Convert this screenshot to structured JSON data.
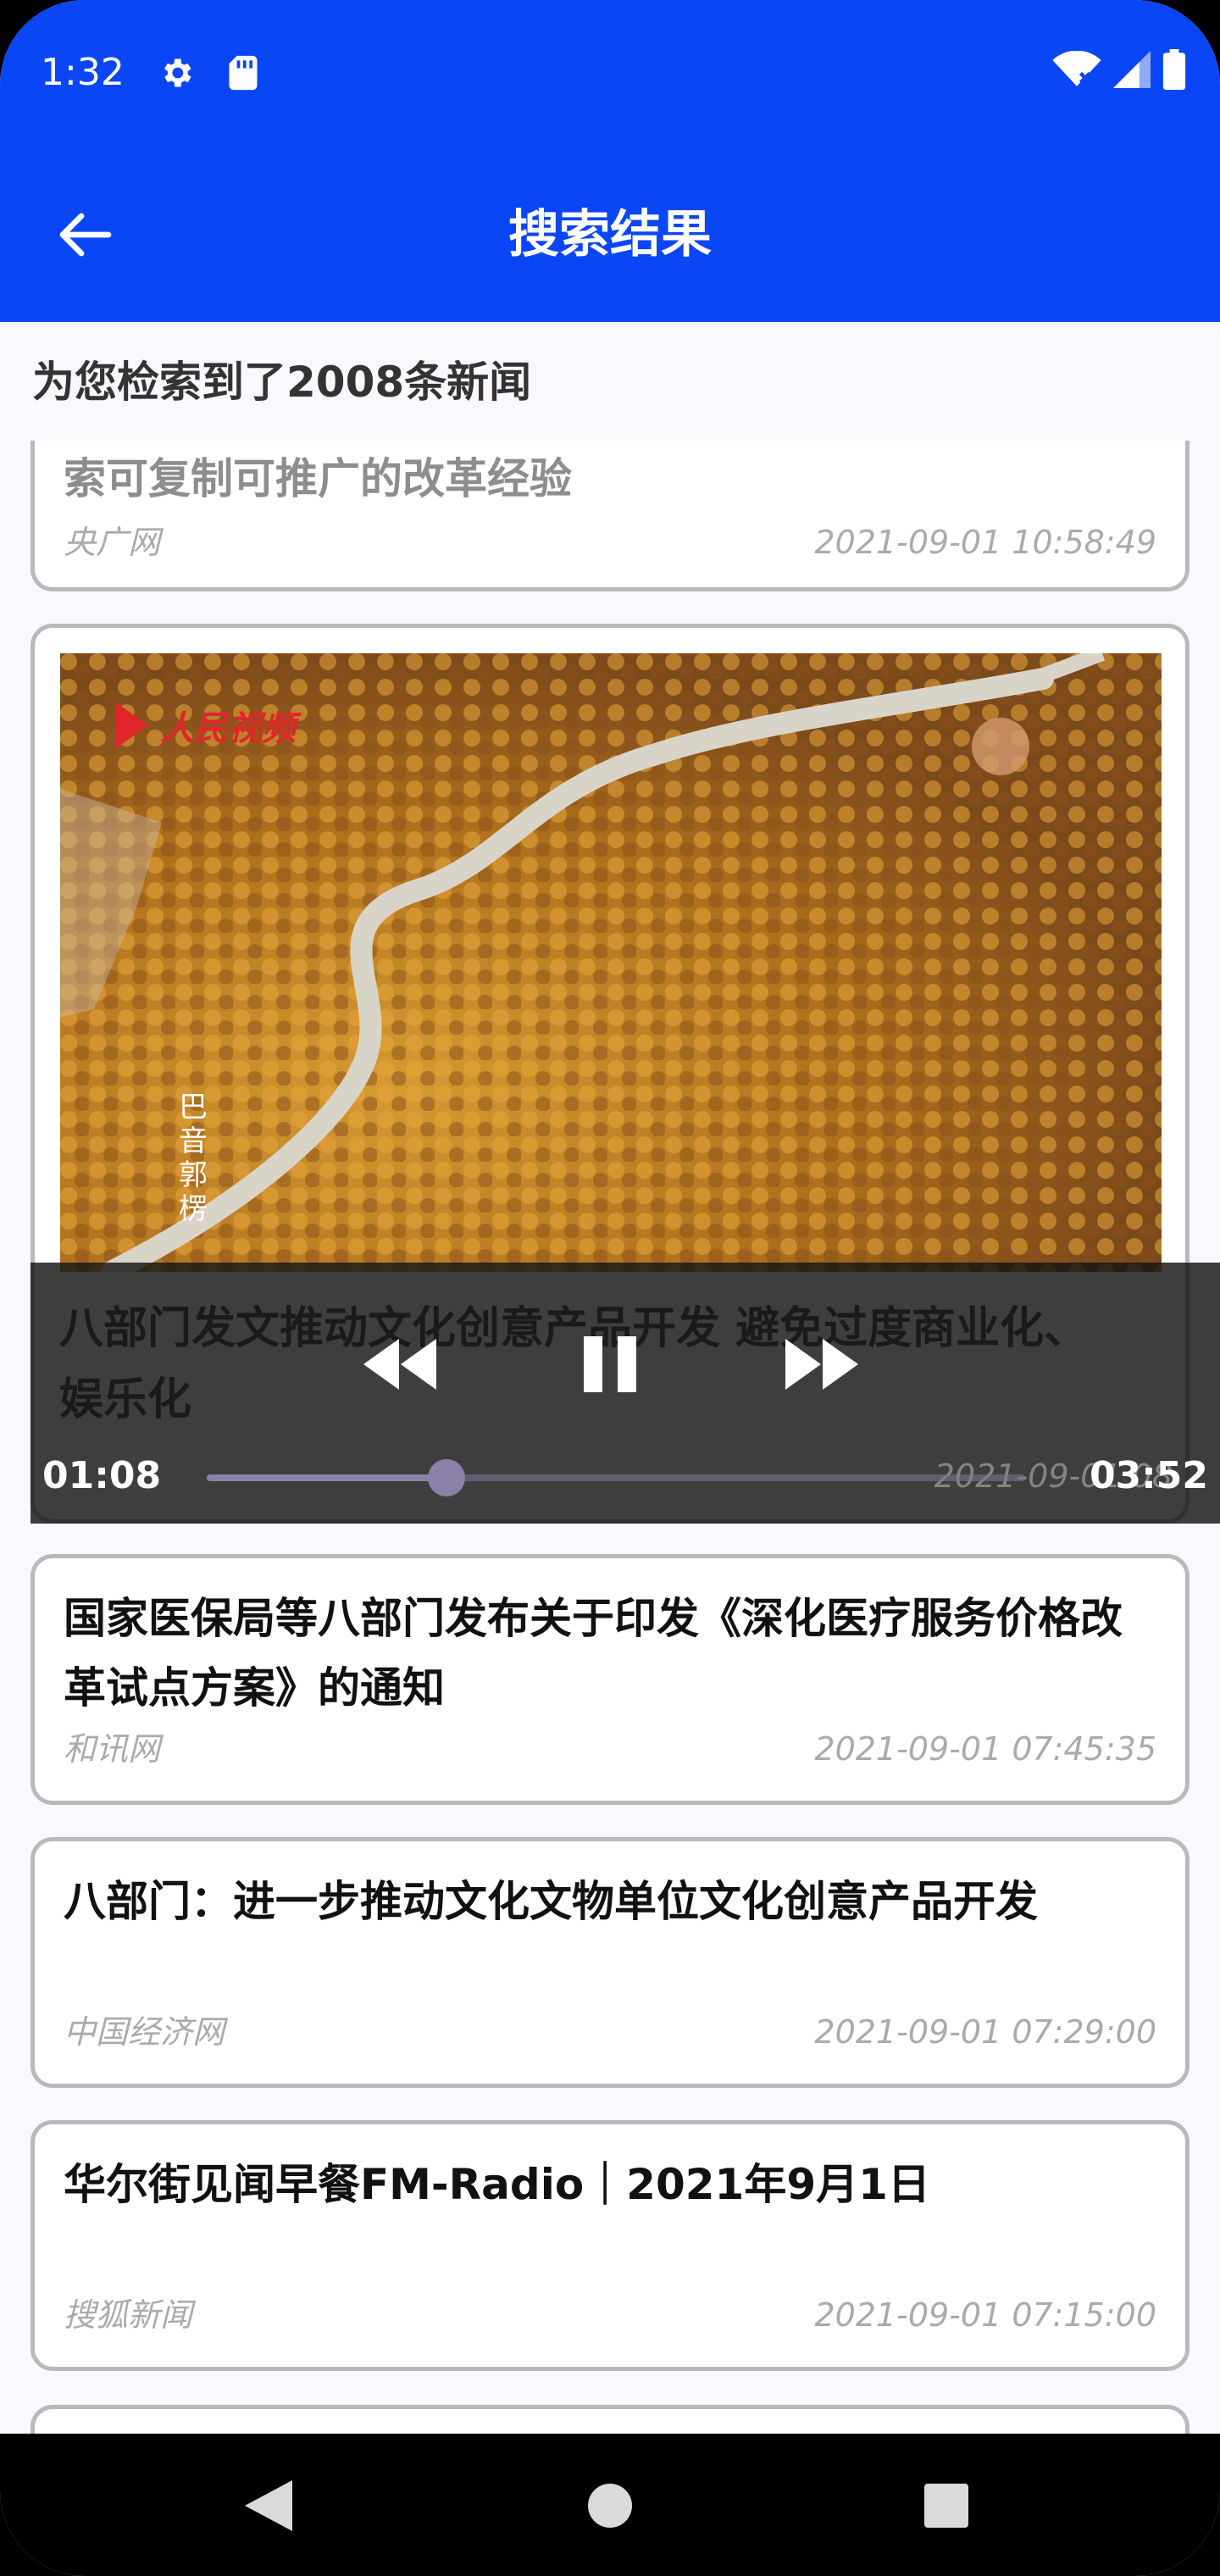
{
  "status_bar": {
    "time": "1:32"
  },
  "app_bar": {
    "title": "搜索结果"
  },
  "result_count": "为您检索到了2008条新闻",
  "articles": [
    {
      "title": "索可复制可推广的改革经验",
      "source": "央广网",
      "time": "2021-09-01 10:58:49"
    },
    {
      "title": "国家医保局等八部门发布关于印发《深化医疗服务价格改革试点方案》的通知",
      "source": "和讯网",
      "time": "2021-09-01 07:45:35"
    },
    {
      "title": "八部门：进一步推动文化文物单位文化创意产品开发",
      "source": "中国经济网",
      "time": "2021-09-01 07:29:00"
    },
    {
      "title": "华尔街见闻早餐FM-Radio｜2021年9月1日",
      "source": "搜狐新闻",
      "time": "2021-09-01 07:15:00"
    }
  ],
  "video_article": {
    "title": "八部门发文推动文化创意产品开发 避免过度商业化、娱乐化",
    "time_partial": "2021-09-01 08",
    "watermark": "人民视频",
    "caption": "巴音郭楞",
    "player": {
      "current": "01:08",
      "duration": "03:52",
      "progress": 0.2931
    }
  },
  "colors": {
    "primary": "#0A46F5",
    "card_border": "#B9B9BD",
    "progress": "#8A80A8"
  },
  "icons": {
    "back": "arrow-left-icon",
    "settings": "gear-icon",
    "sd": "sd-card-icon",
    "wifi": "wifi-icon",
    "signal": "signal-icon",
    "battery": "battery-icon",
    "rewind": "rewind-icon",
    "pause": "pause-icon",
    "forward": "fast-forward-icon",
    "nav_back": "nav-back-icon",
    "nav_home": "nav-home-icon",
    "nav_recents": "nav-recents-icon"
  }
}
